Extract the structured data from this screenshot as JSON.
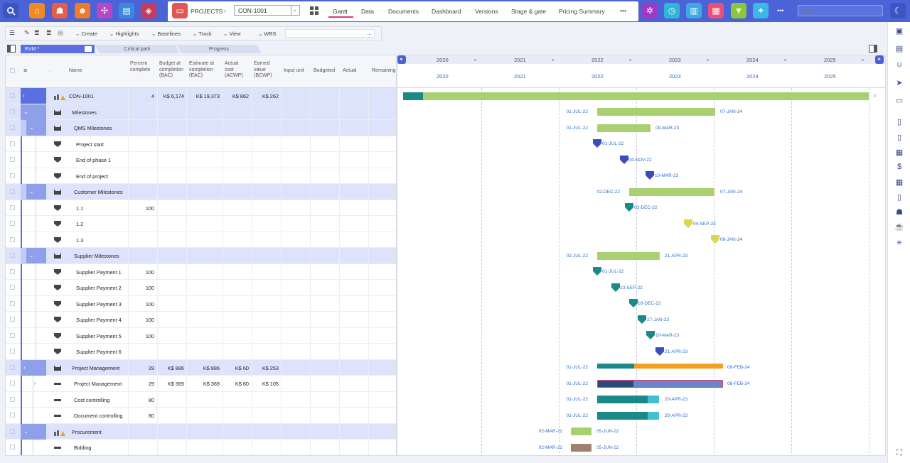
{
  "topbar": {
    "projects_label": "PROJECTS",
    "project_selected": "CON-1001",
    "filter_placeholder": "Filter...",
    "tabs": [
      "Gantt",
      "Data",
      "Documents",
      "Dashboard",
      "Versions",
      "Stage & gate",
      "Pricing Summary"
    ],
    "more": "•••",
    "more2": "•••"
  },
  "toolbar": {
    "create": "Create",
    "highlights": "Highlights",
    "baselines": "Baselines",
    "track": "Track",
    "view": "View",
    "wbs": "WBS",
    "search_dots": "..."
  },
  "ribbon": {
    "evm": "EVM *",
    "critical": "Critical path",
    "progress": "Progress"
  },
  "columns": [
    "Name",
    "Percent complete",
    "Budget at completion (BAC)",
    "Estimate at completion (EAC)",
    "Actual cost (ACWP)",
    "Earned value (BCWP)",
    "Input unit",
    "Budgeted",
    "Actual",
    "Remaining"
  ],
  "rows": [
    {
      "name": "CON-1001",
      "pct": "4",
      "bac": "K$ 6,174",
      "eac": "K$ 19,373",
      "acwp": "K$ 862",
      "bcwp": "K$ 262"
    },
    {
      "name": "Milestones",
      "pct": "",
      "bac": "",
      "eac": "",
      "acwp": "",
      "bcwp": ""
    },
    {
      "name": "QMS Milestones",
      "pct": "",
      "bac": "",
      "eac": "",
      "acwp": "",
      "bcwp": ""
    },
    {
      "name": "Project start",
      "pct": "",
      "bac": "",
      "eac": "",
      "acwp": "",
      "bcwp": ""
    },
    {
      "name": "End of phase 1",
      "pct": "",
      "bac": "",
      "eac": "",
      "acwp": "",
      "bcwp": ""
    },
    {
      "name": "End of project",
      "pct": "",
      "bac": "",
      "eac": "",
      "acwp": "",
      "bcwp": ""
    },
    {
      "name": "Customer Milestones",
      "pct": "",
      "bac": "",
      "eac": "",
      "acwp": "",
      "bcwp": ""
    },
    {
      "name": "1.1",
      "pct": "100",
      "bac": "",
      "eac": "",
      "acwp": "",
      "bcwp": ""
    },
    {
      "name": "1.2",
      "pct": "",
      "bac": "",
      "eac": "",
      "acwp": "",
      "bcwp": ""
    },
    {
      "name": "1.3",
      "pct": "",
      "bac": "",
      "eac": "",
      "acwp": "",
      "bcwp": ""
    },
    {
      "name": "Supplier Milestones",
      "pct": "",
      "bac": "",
      "eac": "",
      "acwp": "",
      "bcwp": ""
    },
    {
      "name": "Supplier Payment 1",
      "pct": "100",
      "bac": "",
      "eac": "",
      "acwp": "",
      "bcwp": ""
    },
    {
      "name": "Supplier Payment 2",
      "pct": "100",
      "bac": "",
      "eac": "",
      "acwp": "",
      "bcwp": ""
    },
    {
      "name": "Supplier Payment 3",
      "pct": "100",
      "bac": "",
      "eac": "",
      "acwp": "",
      "bcwp": ""
    },
    {
      "name": "Supplier Payment 4",
      "pct": "100",
      "bac": "",
      "eac": "",
      "acwp": "",
      "bcwp": ""
    },
    {
      "name": "Supplier Payment 5",
      "pct": "100",
      "bac": "",
      "eac": "",
      "acwp": "",
      "bcwp": ""
    },
    {
      "name": "Supplier Payment 6",
      "pct": "",
      "bac": "",
      "eac": "",
      "acwp": "",
      "bcwp": ""
    },
    {
      "name": "Project Management",
      "pct": "29",
      "bac": "K$ 886",
      "eac": "K$ 886",
      "acwp": "K$ 60",
      "bcwp": "K$ 253"
    },
    {
      "name": "Project Management",
      "pct": "29",
      "bac": "K$ 369",
      "eac": "K$ 369",
      "acwp": "K$ 60",
      "bcwp": "K$ 105"
    },
    {
      "name": "Cost controlling",
      "pct": "80",
      "bac": "",
      "eac": "",
      "acwp": "",
      "bcwp": ""
    },
    {
      "name": "Document controlling",
      "pct": "80",
      "bac": "",
      "eac": "",
      "acwp": "",
      "bcwp": ""
    },
    {
      "name": "Procurement",
      "pct": "",
      "bac": "",
      "eac": "",
      "acwp": "",
      "bcwp": ""
    },
    {
      "name": "Bidding",
      "pct": "",
      "bac": "",
      "eac": "",
      "acwp": "",
      "bcwp": ""
    }
  ],
  "years": [
    "2020",
    "2021",
    "2022",
    "2023",
    "2024",
    "2025",
    "2026"
  ],
  "gantt_labels": {
    "ms_s": "01-JUL-22",
    "ms_e": "07-JAN-24",
    "qms_s": "01-JUL-22",
    "qms_e": "09-MAR-23",
    "ps": "01-JUL-22",
    "ep1": "04-NOV-22",
    "eop": "10-MAR-23",
    "cm_s": "02-DEC-22",
    "cm_e": "07-JAN-24",
    "c11": "02-DEC-22",
    "c12": "04-SEP-23",
    "c13": "08-JAN-24",
    "sm_s": "02-JUL-22",
    "sm_e": "21-APR-23",
    "sp1": "01-JUL-22",
    "sp2": "23-SEP-22",
    "sp3": "16-DEC-22",
    "sp4": "27-JAN-23",
    "sp5": "10-MAR-23",
    "sp6": "21-APR-23",
    "pm_s": "01-JUL-22",
    "pm_e": "08-FEB-24",
    "pm2_s": "01-JUL-22",
    "pm2_e": "08-FEB-24",
    "cc_s": "01-JUL-22",
    "cc_e": "20-APR-23",
    "dc_s": "01-JUL-22",
    "dc_e": "20-APR-23",
    "pr_s": "02-MAR-22",
    "pr_e": "05-JUN-22",
    "bd_s": "02-MAR-22",
    "bd_e": "05-JUN-22",
    "root_e": "0"
  }
}
